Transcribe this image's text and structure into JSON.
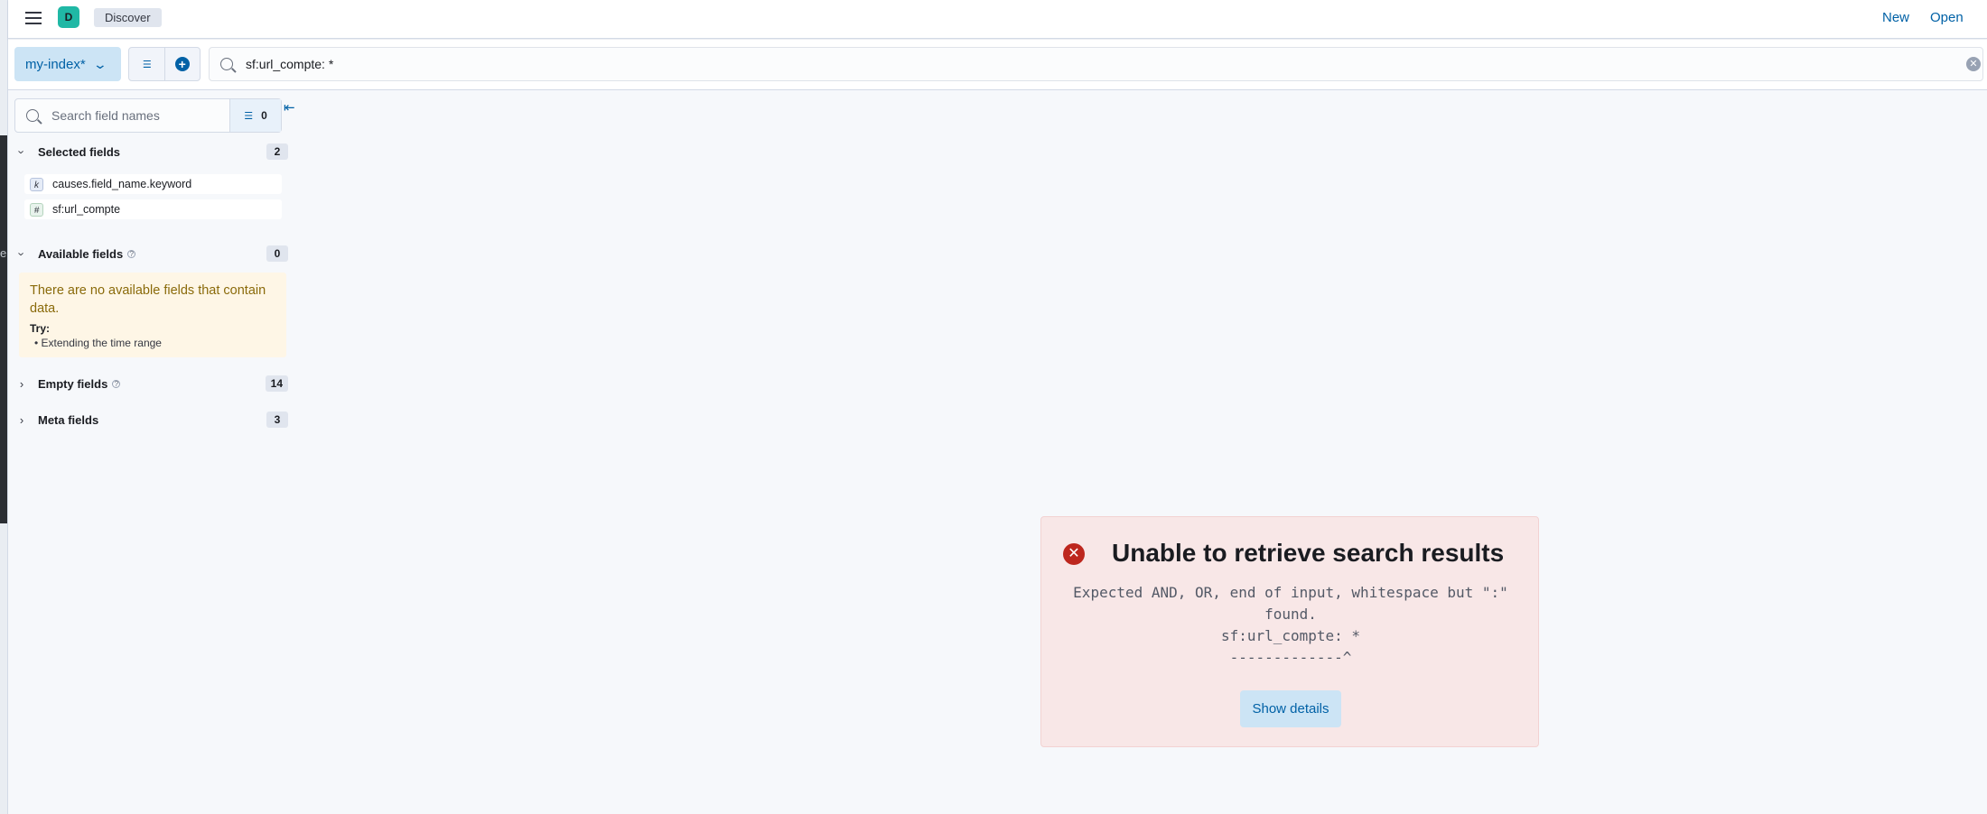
{
  "header": {
    "avatar_letter": "D",
    "breadcrumb": "Discover",
    "new_label": "New",
    "open_label": "Open"
  },
  "querybar": {
    "index_pattern": "my-index*",
    "query": "sf:url_compte: *"
  },
  "sidebar": {
    "search_placeholder": "Search field names",
    "filter_count": "0",
    "selected_fields": {
      "label": "Selected fields",
      "count": "2",
      "items": [
        {
          "type": "k",
          "name": "causes.field_name.keyword"
        },
        {
          "type": "#",
          "name": "sf:url_compte"
        }
      ]
    },
    "available_fields": {
      "label": "Available fields",
      "count": "0",
      "callout_title": "There are no available fields that contain data.",
      "try_label": "Try:",
      "suggestion": "Extending the time range"
    },
    "empty_fields": {
      "label": "Empty fields",
      "count": "14"
    },
    "meta_fields": {
      "label": "Meta fields",
      "count": "3"
    }
  },
  "error": {
    "title": "Unable to retrieve search results",
    "line1": "Expected AND, OR, end of input, whitespace but \":\"",
    "line2": "found.",
    "line3": "sf:url_compte: *",
    "line4": "-------------^",
    "button": "Show details"
  },
  "colors": {
    "accent": "#0061a6",
    "danger": "#bd271e",
    "warning_text": "#8a6a0a",
    "avatar": "#20b8a5"
  }
}
